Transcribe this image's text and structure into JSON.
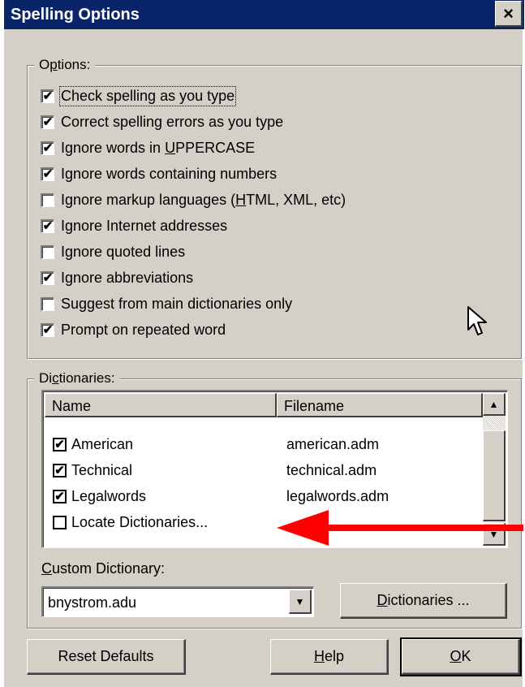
{
  "window": {
    "title": "Spelling Options",
    "close_glyph": "×"
  },
  "options": {
    "legend_pre": "O",
    "legend_u": "p",
    "legend_post": "tions:",
    "items": [
      {
        "label": "Check spelling as you type",
        "checked": true
      },
      {
        "label": "Correct spelling errors as you type",
        "checked": true
      },
      {
        "label_pre": "Ignore words in ",
        "label_u": "U",
        "label_post": "PPERCASE",
        "checked": true
      },
      {
        "label": "Ignore words containing numbers",
        "checked": true
      },
      {
        "label_pre": "Ignore markup languages (",
        "label_u": "H",
        "label_post": "TML, XML, etc)",
        "checked": false
      },
      {
        "label": "Ignore Internet addresses",
        "checked": true
      },
      {
        "label": "Ignore quoted lines",
        "checked": false
      },
      {
        "label": "Ignore abbreviations",
        "checked": true
      },
      {
        "label": "Suggest from main dictionaries only",
        "checked": false
      },
      {
        "label": "Prompt on repeated word",
        "checked": true
      }
    ]
  },
  "dictionaries": {
    "legend_pre": "Di",
    "legend_u": "c",
    "legend_post": "tionaries:",
    "columns": {
      "name": "Name",
      "filename": "Filename"
    },
    "rows": [
      {
        "name": "American",
        "filename": "american.adm",
        "checked": true
      },
      {
        "name": "Technical",
        "filename": "technical.adm",
        "checked": true
      },
      {
        "name": "Legalwords",
        "filename": "legalwords.adm",
        "checked": true
      },
      {
        "name": "Locate Dictionaries...",
        "filename": "",
        "checked": false
      }
    ],
    "custom_label_u": "C",
    "custom_label_post": "ustom Dictionary:",
    "custom_value": "bnystrom.adu",
    "dict_button_u": "D",
    "dict_button_post": "ictionaries ..."
  },
  "buttons": {
    "reset": "Reset Defaults",
    "help_u": "H",
    "help_post": "elp",
    "ok_u": "O",
    "ok_post": "K"
  },
  "annotation": {
    "arrow_color": "#ff0000"
  },
  "colors": {
    "titlebar": "#0a246a",
    "face": "#d4d0c8"
  }
}
